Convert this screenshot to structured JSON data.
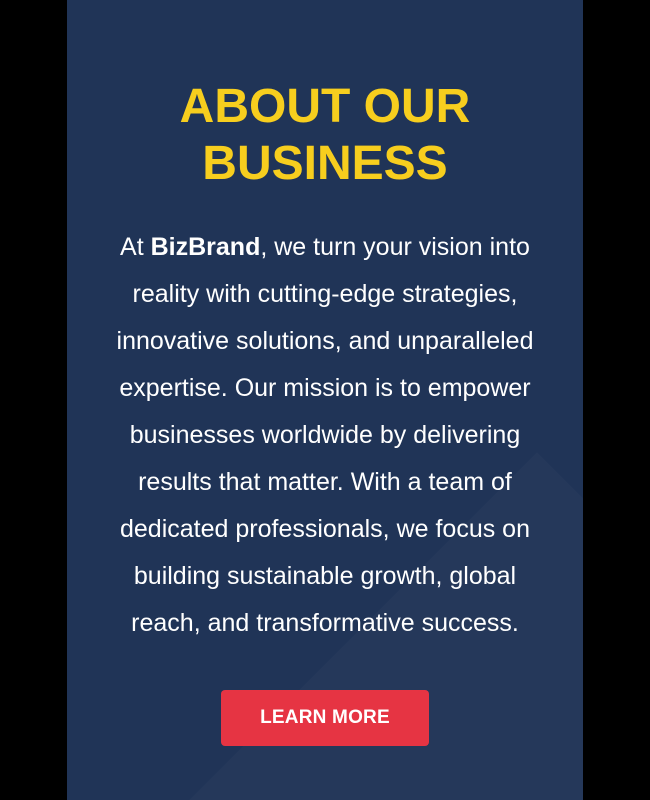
{
  "section": {
    "title_line_1": "ABOUT OUR",
    "title_line_2": "BUSINESS",
    "body": {
      "line_1_prefix": "At ",
      "brand_name": "BizBrand",
      "line_1_suffix": ", we turn your vision into",
      "line_2": "reality with cutting-edge strategies,",
      "line_3": "innovative solutions, and unparalleled",
      "line_4": "expertise. Our mission is to empower",
      "line_5": "businesses worldwide by delivering",
      "line_6": "results that matter. With a team of",
      "line_7": "dedicated professionals, we focus on",
      "line_8": "building sustainable growth, global",
      "line_9": "reach, and transformative success."
    },
    "cta_label": "LEARN MORE"
  },
  "colors": {
    "panel_background": "#203457",
    "title": "#f7ce1e",
    "body_text": "#ffffff",
    "cta_background": "#e63443",
    "outer_background": "#000000"
  }
}
